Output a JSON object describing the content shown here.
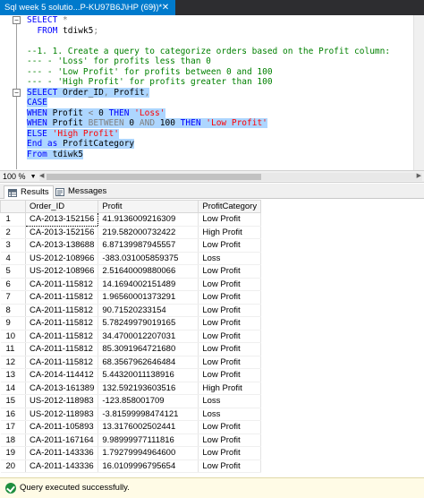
{
  "tab": {
    "title": "Sql week 5 solutio...P-KU97B6J\\HP (69))*",
    "pin_glyph": "⊣",
    "close_glyph": "✕"
  },
  "editor": {
    "collapse_glyph": "−",
    "lines": [
      {
        "selected": false,
        "tokens": [
          [
            "kw",
            "SELECT "
          ],
          [
            "gry",
            "*"
          ]
        ]
      },
      {
        "selected": false,
        "tokens": [
          [
            "kw",
            "  FROM "
          ],
          [
            "plain",
            "tdiwk5"
          ],
          [
            "gry",
            ";"
          ]
        ]
      },
      {
        "selected": false,
        "tokens": []
      },
      {
        "selected": false,
        "tokens": [
          [
            "cmt",
            "--1. 1. Create a query to categorize orders based on the Profit column:"
          ]
        ]
      },
      {
        "selected": false,
        "tokens": [
          [
            "cmt",
            "--- - 'Loss' for profits less than 0"
          ]
        ]
      },
      {
        "selected": false,
        "tokens": [
          [
            "cmt",
            "--- - 'Low Profit' for profits between 0 and 100"
          ]
        ]
      },
      {
        "selected": false,
        "tokens": [
          [
            "cmt",
            "--- - 'High Profit' for profits greater than 100"
          ]
        ]
      },
      {
        "selected": true,
        "tokens": [
          [
            "kw",
            "SELECT "
          ],
          [
            "plain",
            "Order_ID"
          ],
          [
            "gry",
            ", "
          ],
          [
            "plain",
            "Profit"
          ],
          [
            "gry",
            ","
          ]
        ]
      },
      {
        "selected": true,
        "tokens": [
          [
            "kw",
            "CASE"
          ]
        ]
      },
      {
        "selected": true,
        "tokens": [
          [
            "kw",
            "WHEN "
          ],
          [
            "plain",
            "Profit "
          ],
          [
            "gry",
            "< "
          ],
          [
            "plain",
            "0 "
          ],
          [
            "kw",
            "THEN "
          ],
          [
            "str",
            "'Loss'"
          ]
        ]
      },
      {
        "selected": true,
        "tokens": [
          [
            "kw",
            "WHEN "
          ],
          [
            "plain",
            "Profit "
          ],
          [
            "gry",
            "BETWEEN "
          ],
          [
            "plain",
            "0 "
          ],
          [
            "gry",
            "AND "
          ],
          [
            "plain",
            "100 "
          ],
          [
            "kw",
            "THEN "
          ],
          [
            "str",
            "'Low Profit'"
          ]
        ]
      },
      {
        "selected": true,
        "tokens": [
          [
            "kw",
            "ELSE "
          ],
          [
            "str",
            "'High Profit'"
          ]
        ]
      },
      {
        "selected": true,
        "tokens": [
          [
            "kw",
            "End "
          ],
          [
            "kw",
            "as "
          ],
          [
            "plain",
            "ProfitCategory"
          ]
        ]
      },
      {
        "selected": true,
        "tokens": [
          [
            "kw",
            "From "
          ],
          [
            "plain",
            "tdiwk5"
          ]
        ]
      }
    ]
  },
  "zoom": {
    "label": "100 %",
    "arrow": "▼"
  },
  "results_tabs": [
    {
      "label": "Results",
      "icon": "grid-icon",
      "active": true
    },
    {
      "label": "Messages",
      "icon": "messages-icon",
      "active": false
    }
  ],
  "grid": {
    "columns": [
      "Order_ID",
      "Profit",
      "ProfitCategory"
    ],
    "rows": [
      [
        "1",
        "CA-2013-152156",
        "41.9136009216309",
        "Low Profit"
      ],
      [
        "2",
        "CA-2013-152156",
        "219.582000732422",
        "High Profit"
      ],
      [
        "3",
        "CA-2013-138688",
        "6.87139987945557",
        "Low Profit"
      ],
      [
        "4",
        "US-2012-108966",
        "-383.031005859375",
        "Loss"
      ],
      [
        "5",
        "US-2012-108966",
        "2.51640009880066",
        "Low Profit"
      ],
      [
        "6",
        "CA-2011-115812",
        "14.1694002151489",
        "Low Profit"
      ],
      [
        "7",
        "CA-2011-115812",
        "1.96560001373291",
        "Low Profit"
      ],
      [
        "8",
        "CA-2011-115812",
        "90.71520233154",
        "Low Profit"
      ],
      [
        "9",
        "CA-2011-115812",
        "5.78249979019165",
        "Low Profit"
      ],
      [
        "10",
        "CA-2011-115812",
        "34.4700012207031",
        "Low Profit"
      ],
      [
        "11",
        "CA-2011-115812",
        "85.3091964721680",
        "Low Profit"
      ],
      [
        "12",
        "CA-2011-115812",
        "68.3567962646484",
        "Low Profit"
      ],
      [
        "13",
        "CA-2014-114412",
        "5.44320011138916",
        "Low Profit"
      ],
      [
        "14",
        "CA-2013-161389",
        "132.592193603516",
        "High Profit"
      ],
      [
        "15",
        "US-2012-118983",
        "-123.858001709",
        "Loss"
      ],
      [
        "16",
        "US-2012-118983",
        "-3.81599998474121",
        "Loss"
      ],
      [
        "17",
        "CA-2011-105893",
        "13.3176002502441",
        "Low Profit"
      ],
      [
        "18",
        "CA-2011-167164",
        "9.98999977111816",
        "Low Profit"
      ],
      [
        "19",
        "CA-2011-143336",
        "1.79279994964600",
        "Low Profit"
      ],
      [
        "20",
        "CA-2011-143336",
        "16.0109996795654",
        "Low Profit"
      ]
    ]
  },
  "status": {
    "message": "Query executed successfully.",
    "icon": "success-check-icon"
  },
  "colors": {
    "tab_active": "#007acc",
    "selection": "#add6ff",
    "keyword": "#0000ff",
    "string": "#ff0000",
    "comment": "#008000",
    "status_bg": "#fffbe6"
  }
}
